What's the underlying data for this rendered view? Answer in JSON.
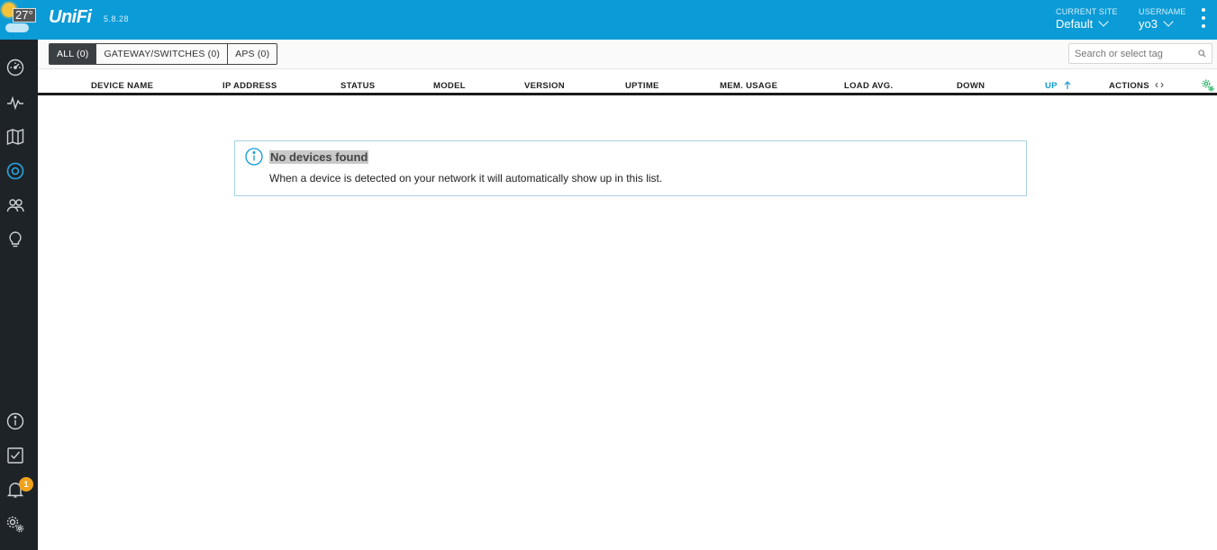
{
  "weather": {
    "temperature": "27°"
  },
  "header": {
    "logo": "UniFi",
    "version": "5.8.28",
    "current_site_caption": "CURRENT SITE",
    "current_site": "Default",
    "username_caption": "USERNAME",
    "username": "yo3"
  },
  "sidebar": {
    "items": [
      {
        "icon": "dashboard-icon"
      },
      {
        "icon": "statistics-icon"
      },
      {
        "icon": "map-icon"
      },
      {
        "icon": "devices-icon"
      },
      {
        "icon": "clients-icon"
      },
      {
        "icon": "insights-icon"
      }
    ],
    "bottom_items": [
      {
        "icon": "info-icon"
      },
      {
        "icon": "tasks-icon"
      },
      {
        "icon": "alerts-icon",
        "badge": "1"
      },
      {
        "icon": "settings-icon"
      }
    ]
  },
  "filter": {
    "tabs": [
      "ALL (0)",
      "GATEWAY/SWITCHES (0)",
      "APS (0)"
    ],
    "active_tab": "ALL (0)",
    "search_placeholder": "Search or select tag"
  },
  "table": {
    "columns": [
      "DEVICE NAME",
      "IP ADDRESS",
      "STATUS",
      "MODEL",
      "VERSION",
      "UPTIME",
      "MEM. USAGE",
      "LOAD AVG.",
      "DOWN",
      "UP",
      "ACTIONS"
    ],
    "sorted_column": "UP"
  },
  "empty_state": {
    "title": "No devices found",
    "message": "When a device is detected on your network it will automatically show up in this list."
  },
  "colors": {
    "brand": "#0b9bd6",
    "sidebar": "#1e2328",
    "badge": "#f0a21b",
    "gear_green": "#2fb56a"
  }
}
